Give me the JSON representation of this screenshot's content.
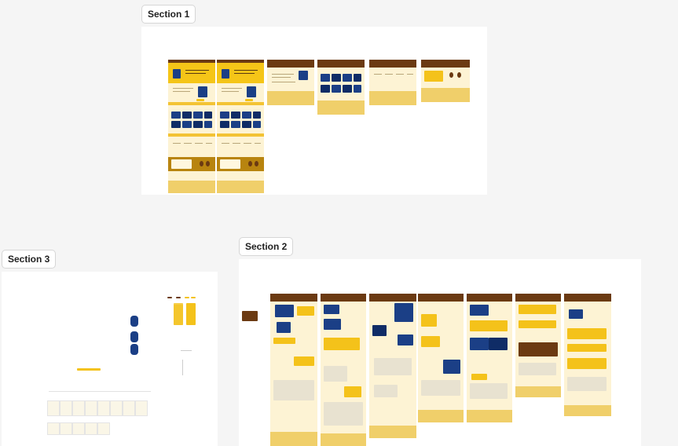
{
  "sections": [
    {
      "id": "section-1",
      "label": "Section 1"
    },
    {
      "id": "section-2",
      "label": "Section 2"
    },
    {
      "id": "section-3",
      "label": "Section 3"
    }
  ],
  "colors": {
    "canvas": "#f5f5f5",
    "section_bg": "#ffffff",
    "brand_brown": "#6b3a12",
    "brand_yellow": "#f5c518",
    "brand_cream": "#fdf3d4",
    "accent_blue": "#1b3f86"
  }
}
